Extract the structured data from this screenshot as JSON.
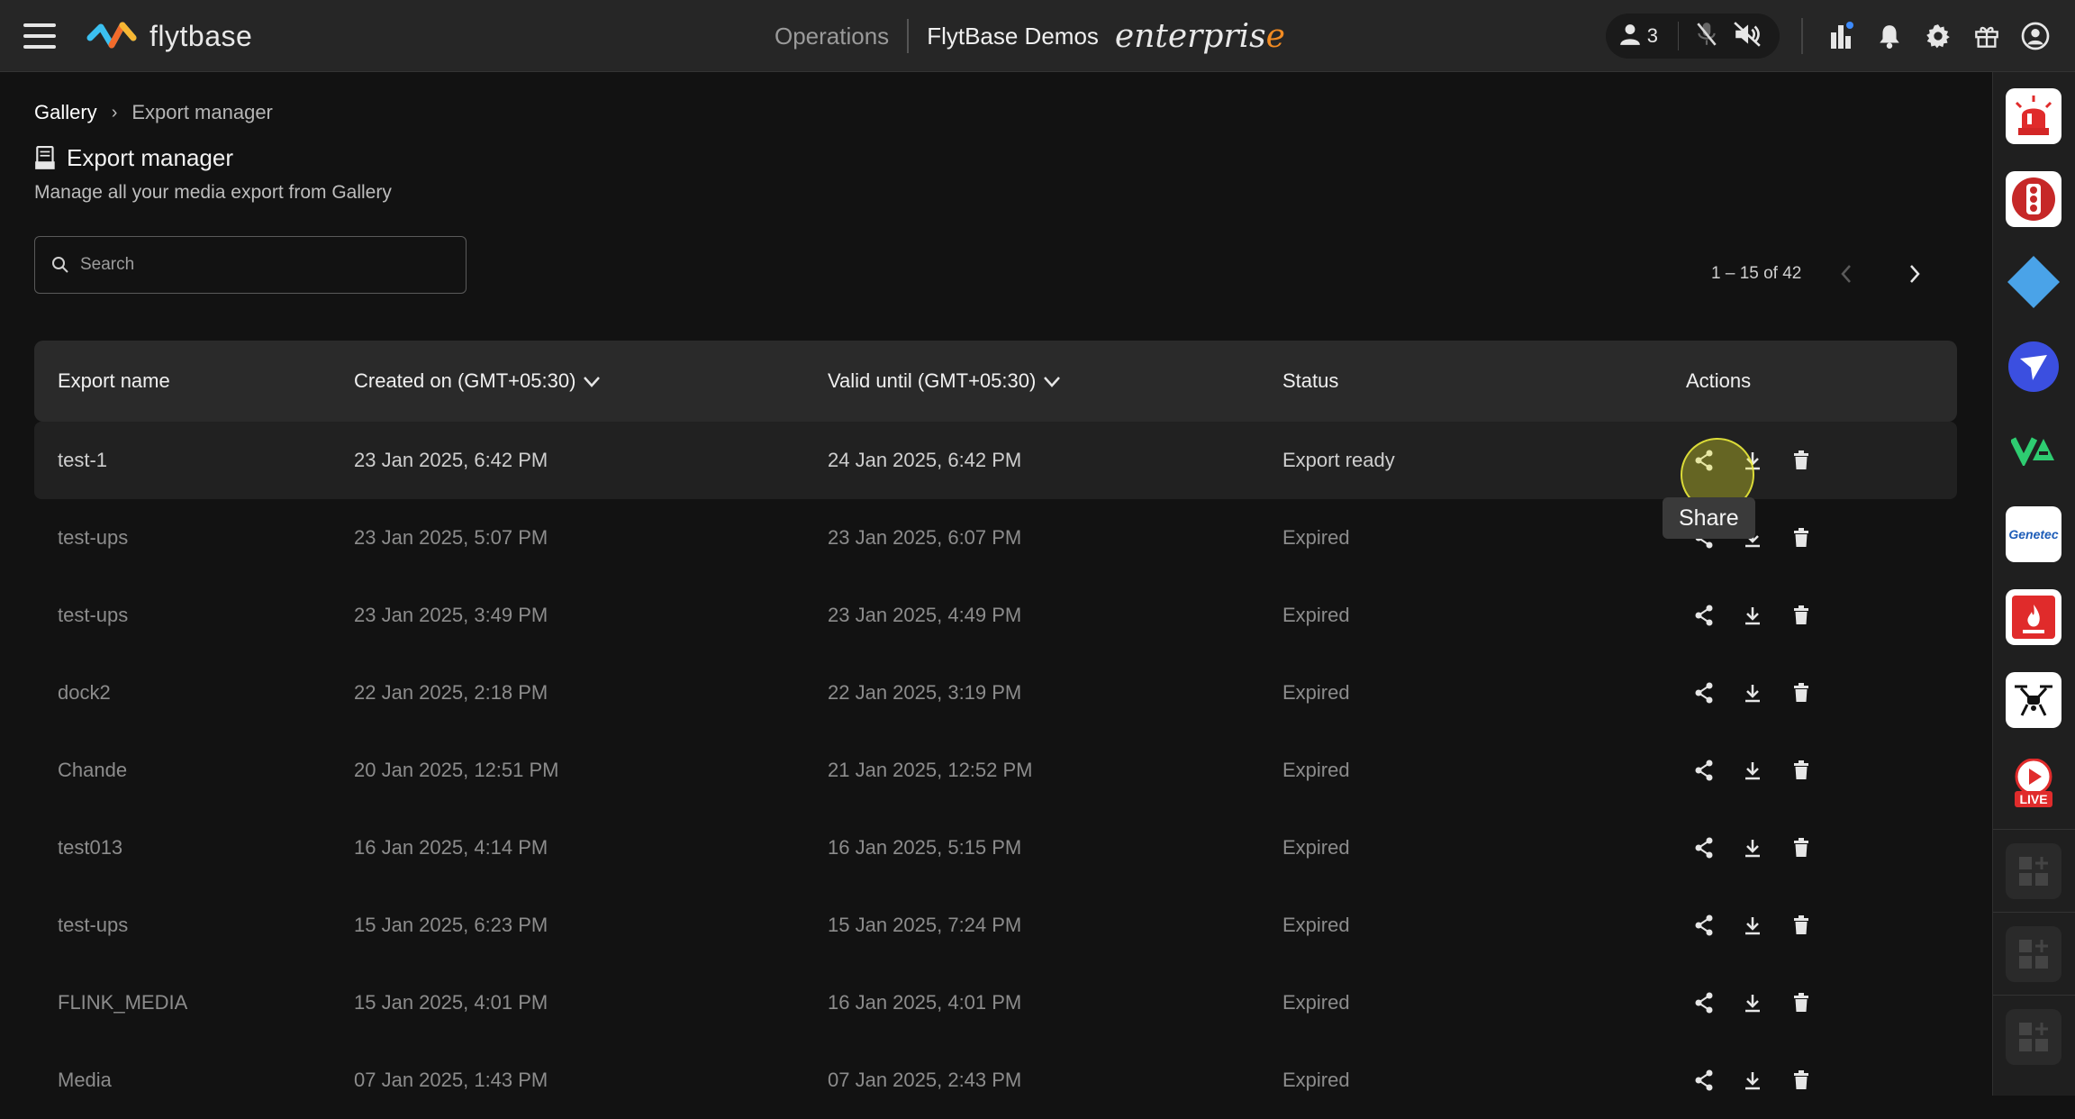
{
  "app": {
    "logo_text": "flytbase",
    "center_link": "Operations",
    "org_name": "FlytBase Demos",
    "edition": "enterpris",
    "edition_last": "e"
  },
  "header": {
    "participants_count": "3",
    "icons": [
      "user-icon",
      "mic-off-icon",
      "speaker-off-icon",
      "bar-chart-icon",
      "bell-icon",
      "gear-icon",
      "gift-icon",
      "account-icon"
    ]
  },
  "breadcrumb": {
    "root": "Gallery",
    "current": "Export manager"
  },
  "page": {
    "title": "Export manager",
    "subtitle": "Manage all your media export from Gallery"
  },
  "search": {
    "placeholder": "Search",
    "value": ""
  },
  "pagination": {
    "range": "1 – 15 of 42"
  },
  "table": {
    "headers": {
      "name": "Export name",
      "created": "Created on (GMT+05:30)",
      "valid": "Valid until (GMT+05:30)",
      "status": "Status",
      "actions": "Actions"
    },
    "rows": [
      {
        "name": "test-1",
        "created": "23 Jan 2025, 6:42 PM",
        "valid": "24 Jan 2025, 6:42 PM",
        "status": "Export ready"
      },
      {
        "name": "test-ups",
        "created": "23 Jan 2025, 5:07 PM",
        "valid": "23 Jan 2025, 6:07 PM",
        "status": "Expired"
      },
      {
        "name": "test-ups",
        "created": "23 Jan 2025, 3:49 PM",
        "valid": "23 Jan 2025, 4:49 PM",
        "status": "Expired"
      },
      {
        "name": "dock2",
        "created": "22 Jan 2025, 2:18 PM",
        "valid": "22 Jan 2025, 3:19 PM",
        "status": "Expired"
      },
      {
        "name": "Chande",
        "created": "20 Jan 2025, 12:51 PM",
        "valid": "21 Jan 2025, 12:52 PM",
        "status": "Expired"
      },
      {
        "name": "test013",
        "created": "16 Jan 2025, 4:14 PM",
        "valid": "16 Jan 2025, 5:15 PM",
        "status": "Expired"
      },
      {
        "name": "test-ups",
        "created": "15 Jan 2025, 6:23 PM",
        "valid": "15 Jan 2025, 7:24 PM",
        "status": "Expired"
      },
      {
        "name": "FLINK_MEDIA",
        "created": "15 Jan 2025, 4:01 PM",
        "valid": "16 Jan 2025, 4:01 PM",
        "status": "Expired"
      },
      {
        "name": "Media",
        "created": "07 Jan 2025, 1:43 PM",
        "valid": "07 Jan 2025, 2:43 PM",
        "status": "Expired"
      }
    ]
  },
  "tooltip": {
    "label": "Share"
  },
  "rail": {
    "items": [
      "siren-icon",
      "traffic-light-icon",
      "diamond-icon",
      "send-icon",
      "va-logo-icon",
      "genetec-icon",
      "fire-alarm-icon",
      "drone-icon",
      "live-icon",
      "add-widget-icon",
      "add-widget-icon",
      "add-widget-icon"
    ],
    "genetec_label": "Genetec",
    "live_label": "LIVE"
  },
  "colors": {
    "accent": "#f28b22",
    "highlight": "#f0f03c",
    "background": "#121212"
  }
}
